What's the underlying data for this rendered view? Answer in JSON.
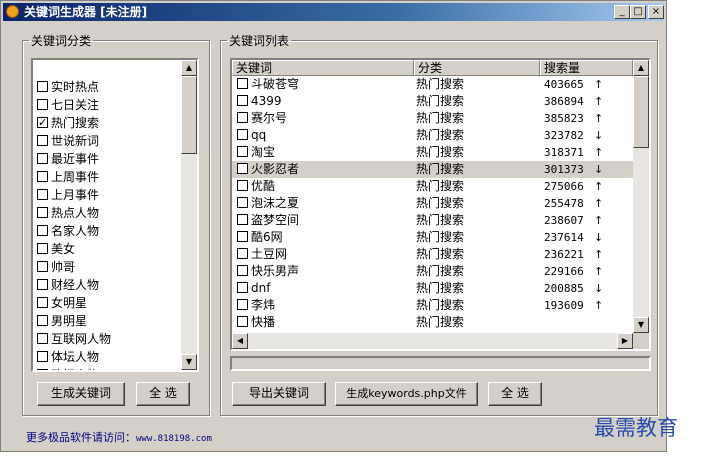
{
  "window": {
    "title": "关键词生成器 [未注册]",
    "controls": [
      "_",
      "□",
      "×"
    ]
  },
  "categories": {
    "legend": "关键词分类",
    "items": [
      {
        "label": "实时热点",
        "checked": false
      },
      {
        "label": "七日关注",
        "checked": false
      },
      {
        "label": "热门搜索",
        "checked": true
      },
      {
        "label": "世说新词",
        "checked": false
      },
      {
        "label": "最近事件",
        "checked": false
      },
      {
        "label": "上周事件",
        "checked": false
      },
      {
        "label": "上月事件",
        "checked": false
      },
      {
        "label": "热点人物",
        "checked": false
      },
      {
        "label": "名家人物",
        "checked": false
      },
      {
        "label": "美女",
        "checked": false
      },
      {
        "label": "帅哥",
        "checked": false
      },
      {
        "label": "财经人物",
        "checked": false
      },
      {
        "label": "女明星",
        "checked": false
      },
      {
        "label": "男明星",
        "checked": false
      },
      {
        "label": "互联网人物",
        "checked": false
      },
      {
        "label": "体坛人物",
        "checked": false
      },
      {
        "label": "政坛人物",
        "checked": false
      }
    ],
    "generate_button": "生成关键词",
    "select_all_button": "全 选"
  },
  "keywords": {
    "legend": "关键词列表",
    "columns": [
      "关键词",
      "分类",
      "搜索量"
    ],
    "rows": [
      {
        "keyword": "斗破苍穹",
        "category": "热门搜索",
        "volume": "403665",
        "trend": "↑"
      },
      {
        "keyword": "4399",
        "category": "热门搜索",
        "volume": "386894",
        "trend": "↑"
      },
      {
        "keyword": "赛尔号",
        "category": "热门搜索",
        "volume": "385823",
        "trend": "↑"
      },
      {
        "keyword": "qq",
        "category": "热门搜索",
        "volume": "323782",
        "trend": "↓"
      },
      {
        "keyword": "淘宝",
        "category": "热门搜索",
        "volume": "318371",
        "trend": "↑"
      },
      {
        "keyword": "火影忍者",
        "category": "热门搜索",
        "volume": "301373",
        "trend": "↓",
        "selected": true
      },
      {
        "keyword": "优酷",
        "category": "热门搜索",
        "volume": "275066",
        "trend": "↑"
      },
      {
        "keyword": "泡沫之夏",
        "category": "热门搜索",
        "volume": "255478",
        "trend": "↑"
      },
      {
        "keyword": "盗梦空间",
        "category": "热门搜索",
        "volume": "238607",
        "trend": "↑"
      },
      {
        "keyword": "酷6网",
        "category": "热门搜索",
        "volume": "237614",
        "trend": "↓"
      },
      {
        "keyword": "土豆网",
        "category": "热门搜索",
        "volume": "236221",
        "trend": "↑"
      },
      {
        "keyword": "快乐男声",
        "category": "热门搜索",
        "volume": "229166",
        "trend": "↑"
      },
      {
        "keyword": "dnf",
        "category": "热门搜索",
        "volume": "200885",
        "trend": "↓"
      },
      {
        "keyword": "李炜",
        "category": "热门搜索",
        "volume": "193609",
        "trend": "↑"
      },
      {
        "keyword": "快播",
        "category": "热门搜索",
        "volume": "",
        "trend": ""
      }
    ],
    "export_button": "导出关键词",
    "generate_php_button": "生成keywords.php文件",
    "select_all_button": "全 选"
  },
  "footer": {
    "text": "更多极品软件请访问：",
    "url": "www.818198.com"
  },
  "watermark": "最需教育"
}
